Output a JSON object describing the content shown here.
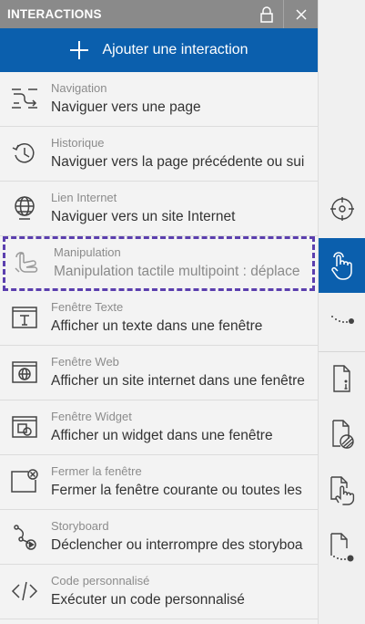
{
  "panel": {
    "title": "INTERACTIONS",
    "add_label": "Ajouter une interaction"
  },
  "items": [
    {
      "category": "Navigation",
      "description": "Naviguer vers une page",
      "icon": "navigation-icon"
    },
    {
      "category": "Historique",
      "description": "Naviguer vers la page précédente ou sui",
      "icon": "history-icon"
    },
    {
      "category": "Lien Internet",
      "description": "Naviguer vers un site Internet",
      "icon": "globe-icon"
    },
    {
      "category": "Manipulation",
      "description": "Manipulation tactile multipoint : déplace",
      "icon": "touch-gesture-icon"
    },
    {
      "category": "Fenêtre Texte",
      "description": "Afficher un texte dans une fenêtre",
      "icon": "text-window-icon"
    },
    {
      "category": "Fenêtre Web",
      "description": "Afficher un site internet dans une fenêtre",
      "icon": "web-window-icon"
    },
    {
      "category": "Fenêtre Widget",
      "description": "Afficher un widget dans une fenêtre",
      "icon": "widget-window-icon"
    },
    {
      "category": "Fermer la fenêtre",
      "description": "Fermer la fenêtre courante ou toutes les",
      "icon": "close-window-icon"
    },
    {
      "category": "Storyboard",
      "description": "Déclencher ou interrompre des storyboa",
      "icon": "storyboard-icon"
    },
    {
      "category": "Code personnalisé",
      "description": "Exécuter un code personnalisé",
      "icon": "code-icon"
    }
  ],
  "rail": [
    {
      "icon": "target-icon",
      "active": false
    },
    {
      "icon": "touch-hand-icon",
      "active": true
    },
    {
      "icon": "motion-path-icon",
      "active": false
    },
    {
      "icon": "file-info-icon",
      "active": false
    },
    {
      "icon": "file-texture-icon",
      "active": false
    },
    {
      "icon": "file-touch-icon",
      "active": false
    },
    {
      "icon": "file-path-icon",
      "active": false
    }
  ],
  "colors": {
    "header": "#8a8a8a",
    "accent": "#0b5fad",
    "selection_outline": "#5b3fae"
  }
}
